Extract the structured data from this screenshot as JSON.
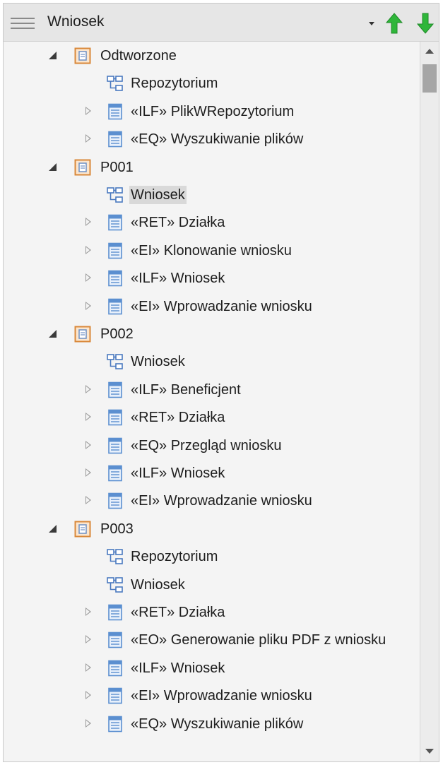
{
  "header": {
    "title": "Wniosek"
  },
  "tree": [
    {
      "label": "Odtworzone",
      "type": "package",
      "expander": "open",
      "level": 0
    },
    {
      "label": "Repozytorium",
      "type": "diagram",
      "expander": "none",
      "level": 1
    },
    {
      "label": "«ILF» PlikWRepozytorium",
      "type": "element",
      "expander": "closed",
      "level": 1
    },
    {
      "label": "«EQ» Wyszukiwanie plików",
      "type": "element",
      "expander": "closed",
      "level": 1
    },
    {
      "label": "P001",
      "type": "package",
      "expander": "open",
      "level": 0
    },
    {
      "label": "Wniosek",
      "type": "diagram",
      "expander": "none",
      "level": 1,
      "selected": true
    },
    {
      "label": "«RET» Działka",
      "type": "element",
      "expander": "closed",
      "level": 1
    },
    {
      "label": "«EI» Klonowanie wniosku",
      "type": "element",
      "expander": "closed",
      "level": 1
    },
    {
      "label": "«ILF» Wniosek",
      "type": "element",
      "expander": "closed",
      "level": 1
    },
    {
      "label": "«EI» Wprowadzanie wniosku",
      "type": "element",
      "expander": "closed",
      "level": 1
    },
    {
      "label": "P002",
      "type": "package",
      "expander": "open",
      "level": 0
    },
    {
      "label": "Wniosek",
      "type": "diagram",
      "expander": "none",
      "level": 1
    },
    {
      "label": "«ILF» Beneficjent",
      "type": "element",
      "expander": "closed",
      "level": 1
    },
    {
      "label": "«RET» Działka",
      "type": "element",
      "expander": "closed",
      "level": 1
    },
    {
      "label": "«EQ» Przegląd wniosku",
      "type": "element",
      "expander": "closed",
      "level": 1
    },
    {
      "label": "«ILF» Wniosek",
      "type": "element",
      "expander": "closed",
      "level": 1
    },
    {
      "label": "«EI» Wprowadzanie wniosku",
      "type": "element",
      "expander": "closed",
      "level": 1
    },
    {
      "label": "P003",
      "type": "package",
      "expander": "open",
      "level": 0
    },
    {
      "label": "Repozytorium",
      "type": "diagram",
      "expander": "none",
      "level": 1
    },
    {
      "label": "Wniosek",
      "type": "diagram",
      "expander": "none",
      "level": 1
    },
    {
      "label": "«RET» Działka",
      "type": "element",
      "expander": "closed",
      "level": 1
    },
    {
      "label": "«EO» Generowanie pliku PDF z wniosku",
      "type": "element",
      "expander": "closed",
      "level": 1
    },
    {
      "label": "«ILF» Wniosek",
      "type": "element",
      "expander": "closed",
      "level": 1
    },
    {
      "label": "«EI» Wprowadzanie wniosku",
      "type": "element",
      "expander": "closed",
      "level": 1
    },
    {
      "label": "«EQ» Wyszukiwanie plików",
      "type": "element",
      "expander": "closed",
      "level": 1
    }
  ],
  "colors": {
    "arrow_green": "#2fb63a",
    "package_orange": "#e8a05a",
    "element_blue": "#5b8fd0"
  }
}
